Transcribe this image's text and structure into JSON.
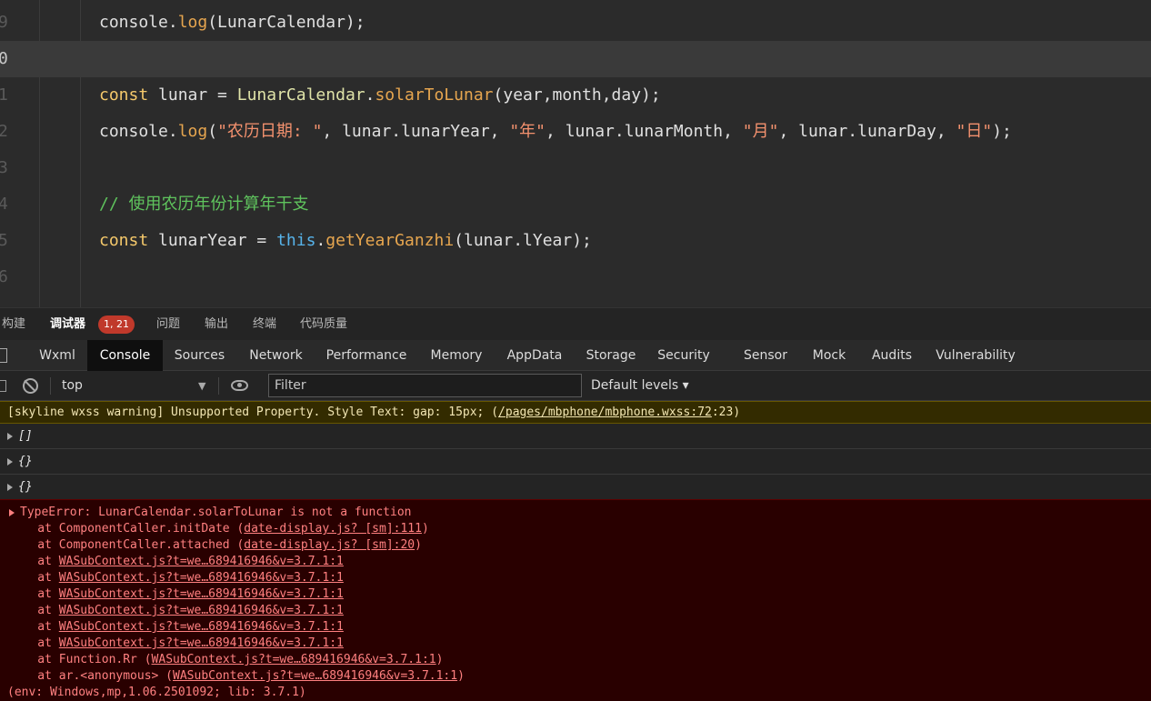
{
  "editor": {
    "lines": [
      {
        "num": "9",
        "tokens": [
          [
            "plain",
            "console."
          ],
          [
            "fn",
            "log"
          ],
          [
            "plain",
            "(LunarCalendar);"
          ]
        ]
      },
      {
        "num": "0",
        "tokens": []
      },
      {
        "num": "1",
        "tokens": [
          [
            "kw",
            "const"
          ],
          [
            "plain",
            " lunar = "
          ],
          [
            "cls",
            "LunarCalendar"
          ],
          [
            "plain",
            "."
          ],
          [
            "fn",
            "solarToLunar"
          ],
          [
            "plain",
            "(year,month,day);"
          ]
        ]
      },
      {
        "num": "2",
        "tokens": [
          [
            "plain",
            "console."
          ],
          [
            "fn",
            "log"
          ],
          [
            "plain",
            "("
          ],
          [
            "str",
            "\"农历日期: \""
          ],
          [
            "plain",
            ", lunar.lunarYear, "
          ],
          [
            "str",
            "\"年\""
          ],
          [
            "plain",
            ", lunar.lunarMonth, "
          ],
          [
            "str",
            "\"月\""
          ],
          [
            "plain",
            ", lunar.lunarDay, "
          ],
          [
            "str",
            "\"日\""
          ],
          [
            "plain",
            ");"
          ]
        ]
      },
      {
        "num": "3",
        "tokens": []
      },
      {
        "num": "4",
        "tokens": [
          [
            "cmt",
            "// 使用农历年份计算年干支"
          ]
        ]
      },
      {
        "num": "5",
        "tokens": [
          [
            "kw",
            "const"
          ],
          [
            "plain",
            " lunarYear = "
          ],
          [
            "this",
            "this"
          ],
          [
            "plain",
            "."
          ],
          [
            "fn",
            "getYearGanzhi"
          ],
          [
            "plain",
            "(lunar.lYear);"
          ]
        ]
      },
      {
        "num": "6",
        "tokens": []
      }
    ]
  },
  "panel_tabs": {
    "build": "构建",
    "debugger": "调试器",
    "badge": "1, 21",
    "issues": "问题",
    "output": "输出",
    "terminal": "终端",
    "quality": "代码质量"
  },
  "dev_tabs": [
    "Wxml",
    "Console",
    "Sources",
    "Network",
    "Performance",
    "Memory",
    "AppData",
    "Storage",
    "Security",
    "Sensor",
    "Mock",
    "Audits",
    "Vulnerability"
  ],
  "toolbar": {
    "context": "top",
    "filter_placeholder": "Filter",
    "levels": "Default levels ▾"
  },
  "console": {
    "warning_prefix": "[skyline wxss warning] Unsupported Property. Style Text: gap: 15px; (",
    "warning_link": "/pages/mbphone/mbphone.wxss:72",
    "warning_suffix": ":23)",
    "objects": [
      "[]",
      "{}",
      "{}"
    ],
    "error_title": "TypeError: LunarCalendar.solarToLunar is not a function",
    "stack": [
      {
        "pre": "    at ComponentCaller.initDate (",
        "link": "date-display.js? [sm]:111",
        "post": ")"
      },
      {
        "pre": "    at ComponentCaller.attached (",
        "link": "date-display.js? [sm]:20",
        "post": ")"
      },
      {
        "pre": "    at ",
        "link": "WASubContext.js?t=we…689416946&v=3.7.1:1",
        "post": ""
      },
      {
        "pre": "    at ",
        "link": "WASubContext.js?t=we…689416946&v=3.7.1:1",
        "post": ""
      },
      {
        "pre": "    at ",
        "link": "WASubContext.js?t=we…689416946&v=3.7.1:1",
        "post": ""
      },
      {
        "pre": "    at ",
        "link": "WASubContext.js?t=we…689416946&v=3.7.1:1",
        "post": ""
      },
      {
        "pre": "    at ",
        "link": "WASubContext.js?t=we…689416946&v=3.7.1:1",
        "post": ""
      },
      {
        "pre": "    at ",
        "link": "WASubContext.js?t=we…689416946&v=3.7.1:1",
        "post": ""
      },
      {
        "pre": "    at Function.Rr (",
        "link": "WASubContext.js?t=we…689416946&v=3.7.1:1",
        "post": ")"
      },
      {
        "pre": "    at ar.<anonymous> (",
        "link": "WASubContext.js?t=we…689416946&v=3.7.1:1",
        "post": ")"
      }
    ],
    "env": "(env: Windows,mp,1.06.2501092; lib: 3.7.1)"
  }
}
